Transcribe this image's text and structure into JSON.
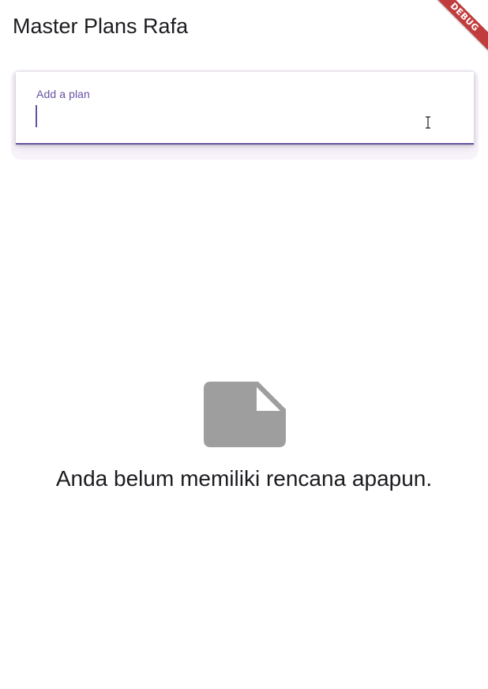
{
  "app_bar": {
    "title": "Master Plans Rafa"
  },
  "debug_banner": {
    "label": "DEBUG",
    "color": "#b71c1c"
  },
  "plan_input": {
    "label": "Add a plan",
    "value": "",
    "accent_color": "#6750a4"
  },
  "empty_state": {
    "icon": "note-icon",
    "message": "Anda belum memiliki rencana apapun.",
    "icon_color": "#9e9e9e"
  },
  "cursor": {
    "icon": "text-cursor-icon"
  }
}
